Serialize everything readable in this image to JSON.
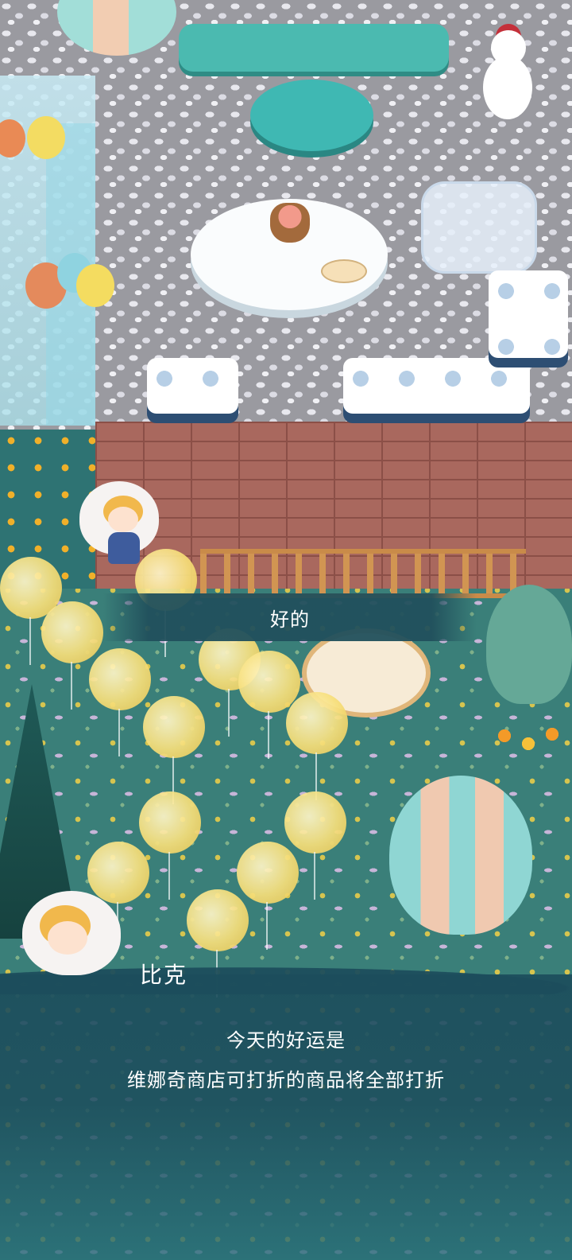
{
  "choice": {
    "label": "好的"
  },
  "dialog": {
    "speaker": "比克",
    "lines": [
      "今天的好运是",
      "维娜奇商店可打折的商品将全部打折"
    ]
  },
  "colors": {
    "panel": "#1c4d5c",
    "text": "#ffffff",
    "garden": "#3a7f79",
    "floor": "#9a9aa0",
    "brick": "#a9685e"
  },
  "icons": {
    "speaker_avatar": "character-portrait",
    "player": "player-character"
  }
}
